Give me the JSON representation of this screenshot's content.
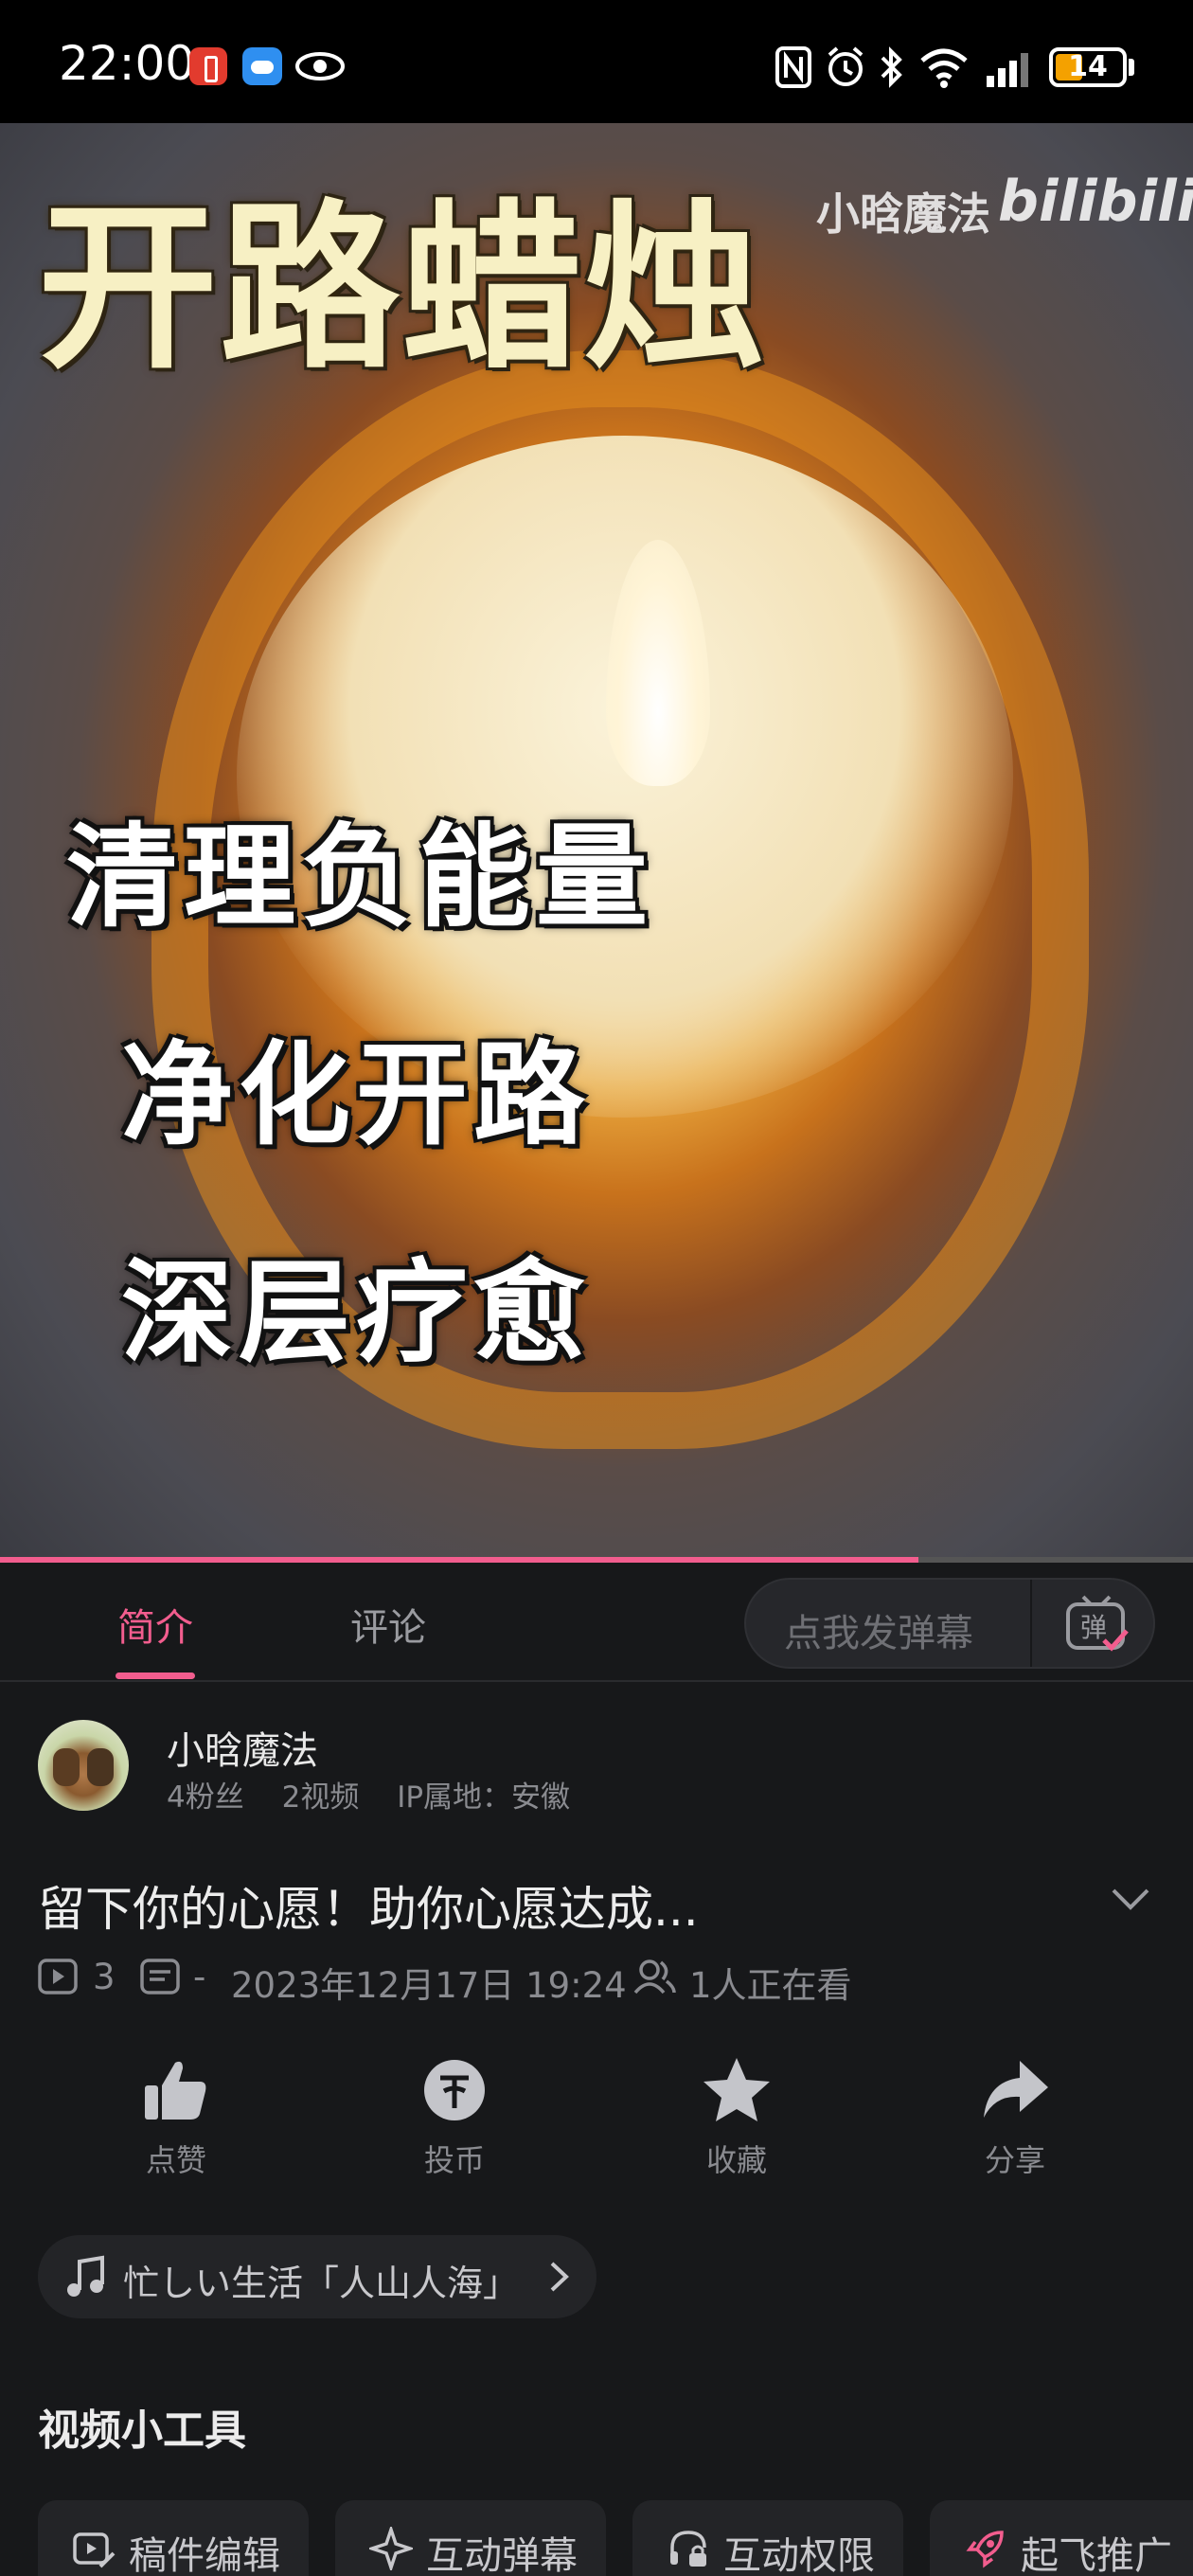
{
  "status_bar": {
    "time": "22:00",
    "battery": "14"
  },
  "video": {
    "title_overlay": "开路蜡烛",
    "watermark_author": "小晗魔法",
    "watermark_brand": "bilibili",
    "captions": [
      "清理负能量",
      "净化开路",
      "深层疗愈"
    ],
    "progress": 0.77
  },
  "tabs": {
    "intro": "简介",
    "comments": "评论",
    "danmaku_placeholder": "点我发弹幕",
    "danmaku_icon_text": "弹"
  },
  "author": {
    "name": "小晗魔法",
    "fans": "4粉丝",
    "videos": "2视频",
    "ip": "IP属地：安徽"
  },
  "video_info": {
    "headline": "留下你的心愿！助你心愿达成...",
    "play_count": "3",
    "danmaku_count": "-",
    "date": "2023年12月17日 19:24",
    "watching": "1人正在看"
  },
  "actions": [
    {
      "label": "点赞",
      "icon": "thumbs-up-icon"
    },
    {
      "label": "投币",
      "icon": "coin-icon"
    },
    {
      "label": "收藏",
      "icon": "star-icon"
    },
    {
      "label": "分享",
      "icon": "share-icon"
    }
  ],
  "music": {
    "text": "忙しい生活「人山人海」"
  },
  "tools": {
    "title": "视频小工具",
    "items": [
      "稿件编辑",
      "互动弹幕",
      "互动权限",
      "起飞推广"
    ]
  },
  "colors": {
    "accent": "#f25d8e",
    "background": "#17181a",
    "muted_text": "#8a8b90"
  }
}
